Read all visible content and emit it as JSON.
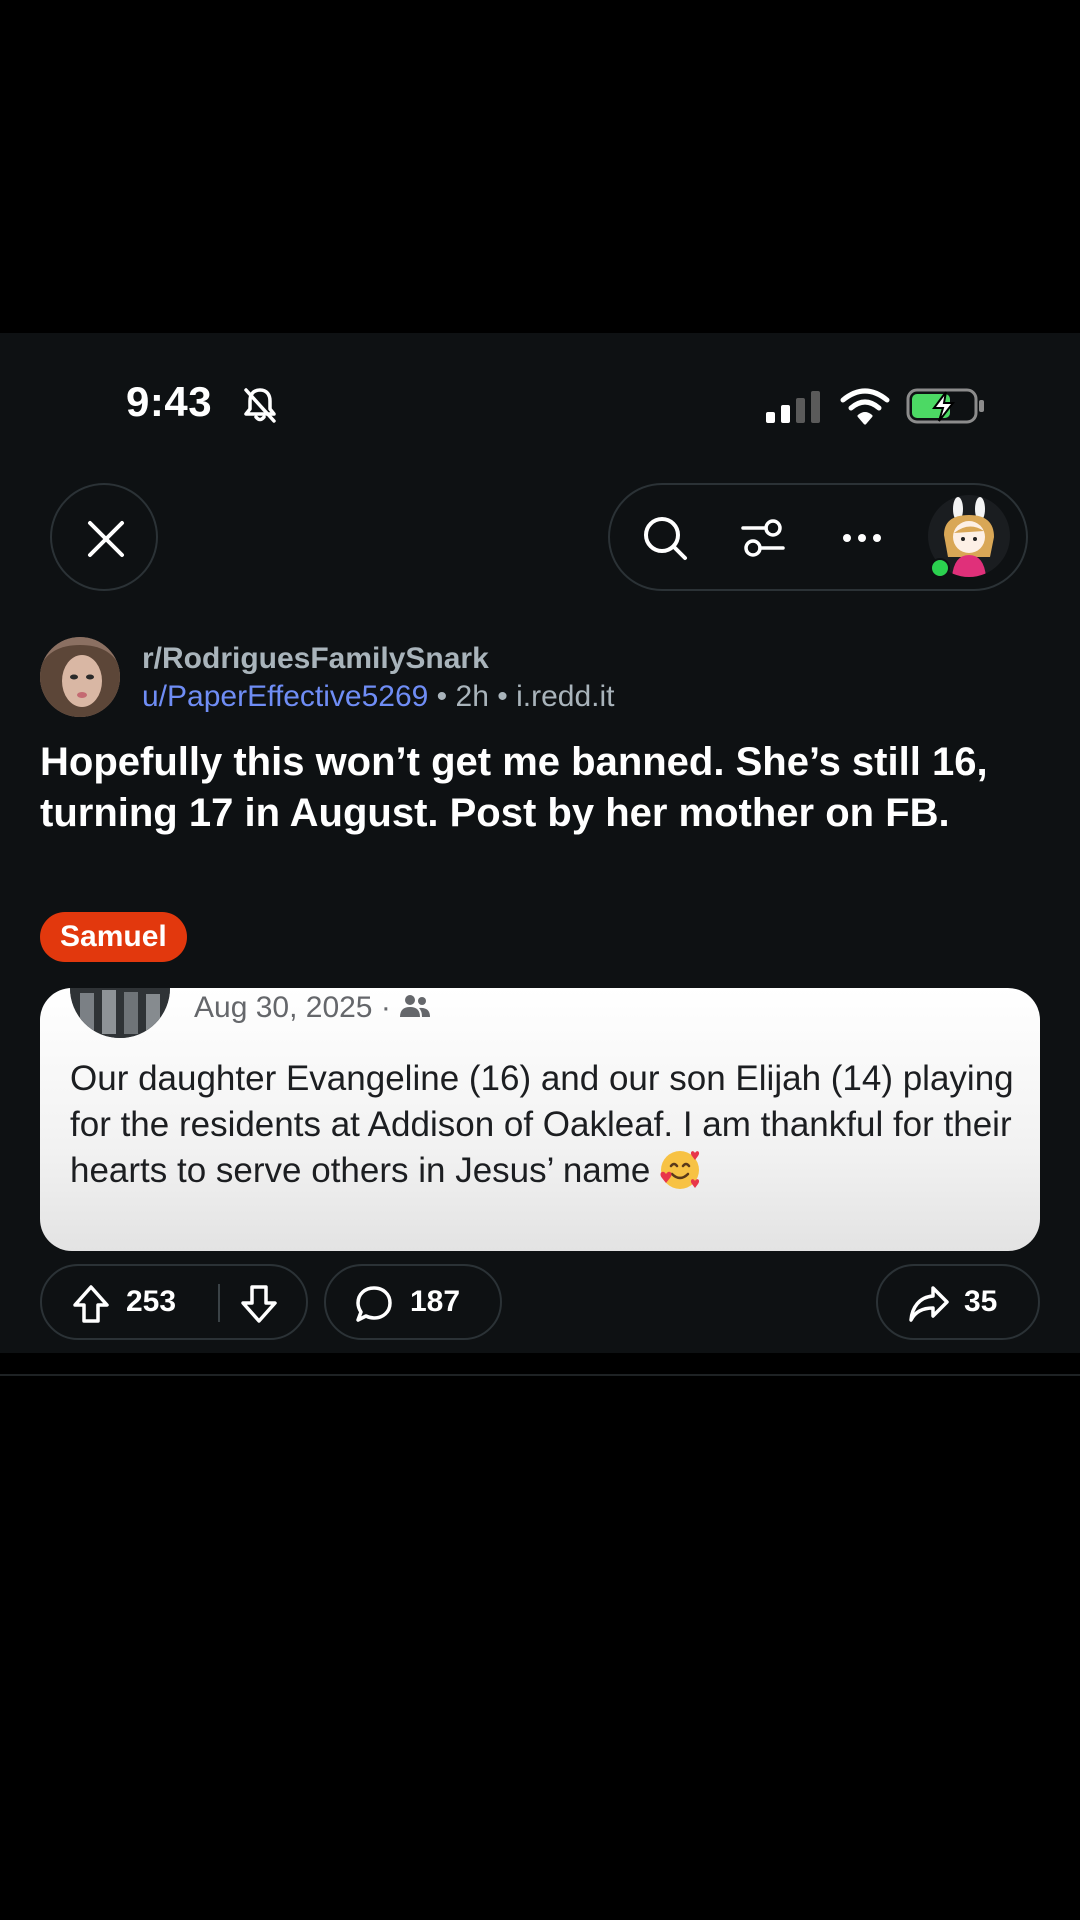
{
  "status_bar": {
    "time": "9:43",
    "icons": [
      "bell-off-icon",
      "signal-icon",
      "wifi-icon",
      "battery-charging-icon"
    ]
  },
  "toolbar": {
    "close_icon": "close-icon",
    "action_icons": [
      "search-icon",
      "filter-icon",
      "more-icon",
      "user-avatar"
    ]
  },
  "post": {
    "subreddit": "r/RodriguesFamilySnark",
    "author": "u/PaperEffective5269",
    "separator": "•",
    "age": "2h",
    "domain": "i.redd.it",
    "title": "Hopefully this won’t get me banned. She’s still 16, turning 17 in August. Post by her mother on FB.",
    "flair": "Samuel",
    "flair_color": "#e2380d"
  },
  "embedded_post": {
    "date": "Aug 30, 2025 ·",
    "audience_icon": "friends-icon",
    "text": "Our daughter Evangeline (16) and our son Elijah (14) playing for the residents at Addison of Oakleaf. I am thankful for their hearts to serve others in Jesus’ name",
    "emoji": "smiling-face-with-hearts"
  },
  "actions": {
    "upvotes": "253",
    "comments": "187",
    "shares": "35"
  },
  "colors": {
    "background": "#0e1113",
    "link_blue": "#6f8df5",
    "meta_gray": "#a9b4bb"
  }
}
